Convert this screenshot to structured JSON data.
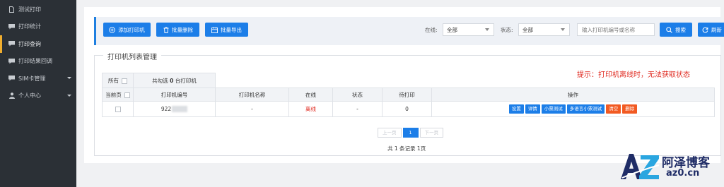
{
  "sidebar": {
    "items": [
      {
        "label": "测试打印",
        "icon": "file-icon"
      },
      {
        "label": "打印统计",
        "icon": "chat-icon"
      },
      {
        "label": "打印查询",
        "icon": "chat-icon",
        "active": true
      },
      {
        "label": "打印结果回调",
        "icon": "chat-icon"
      },
      {
        "label": "SIM卡管理",
        "icon": "chat-icon",
        "has_caret": true
      },
      {
        "label": "个人中心",
        "icon": "user-icon",
        "has_caret": true
      }
    ]
  },
  "toolbar": {
    "add_label": "添加打印机",
    "batch_delete_label": "批量删除",
    "batch_export_label": "批量导出",
    "online_label": "在线:",
    "online_value": "全部",
    "status_label": "状态:",
    "status_value": "全部",
    "search_placeholder": "输入打印机编号或名称",
    "search_label": "搜索",
    "refresh_label": "刷新"
  },
  "panel": {
    "legend": "打印机列表管理",
    "tip": "提示：打印机离线时，无法获取状态"
  },
  "table": {
    "all_label": "所有",
    "selected_prefix": "共勾选",
    "selected_count": "0",
    "selected_suffix": "台打印机",
    "page_label": "当前页",
    "columns": [
      "打印机编号",
      "打印机名称",
      "在线",
      "状态",
      "待打印",
      "操作"
    ],
    "rows": [
      {
        "sn": "922",
        "name": "-",
        "online": "离线",
        "status": "-",
        "pending": "0"
      }
    ],
    "actions": [
      {
        "label": "设置",
        "color": "#1c7ee8"
      },
      {
        "label": "详情",
        "color": "#1c7ee8"
      },
      {
        "label": "小票测试",
        "color": "#1c7ee8"
      },
      {
        "label": "多语言小票测试",
        "color": "#1c7ee8"
      },
      {
        "label": "清空",
        "color": "#f25a22"
      },
      {
        "label": "删除",
        "color": "#f25a22"
      }
    ]
  },
  "pagination": {
    "prev_label": "上一页",
    "current_page": "1",
    "next_label": "下一页",
    "total_text": "共 1 条记录 1页"
  },
  "watermark": {
    "logo_text": "AZ",
    "cn": "阿泽博客",
    "en": "az0.cn"
  }
}
